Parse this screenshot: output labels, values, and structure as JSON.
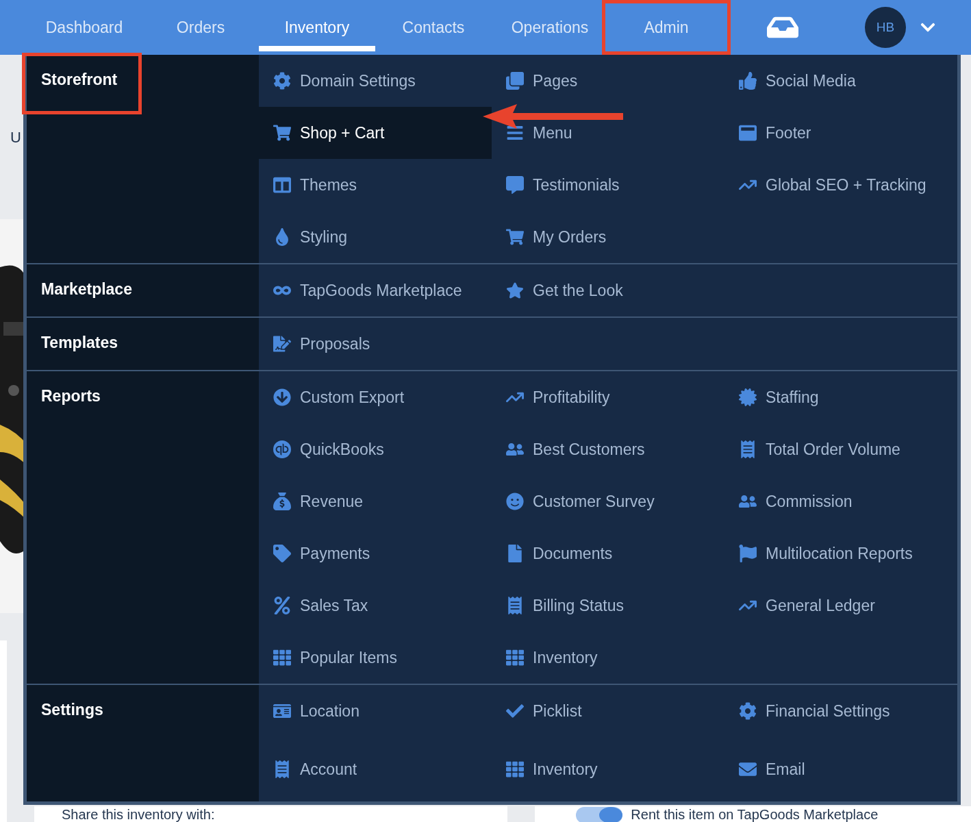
{
  "nav": {
    "items": [
      {
        "label": "Dashboard",
        "selected": false,
        "highlighted": false
      },
      {
        "label": "Orders",
        "selected": false,
        "highlighted": false
      },
      {
        "label": "Inventory",
        "selected": true,
        "highlighted": false
      },
      {
        "label": "Contacts",
        "selected": false,
        "highlighted": false
      },
      {
        "label": "Operations",
        "selected": false,
        "highlighted": false
      },
      {
        "label": "Admin",
        "selected": false,
        "highlighted": true
      }
    ],
    "avatar": "HB"
  },
  "menu": {
    "sections": [
      {
        "title": "Storefront",
        "highlighted": true,
        "items": [
          {
            "label": "Domain Settings",
            "selected": false,
            "pointed": false
          },
          {
            "label": "Pages",
            "selected": false,
            "pointed": false
          },
          {
            "label": "Social Media",
            "selected": false,
            "pointed": false
          },
          {
            "label": "Shop + Cart",
            "selected": true,
            "pointed": true
          },
          {
            "label": "Menu",
            "selected": false,
            "pointed": false
          },
          {
            "label": "Footer",
            "selected": false,
            "pointed": false
          },
          {
            "label": "Themes",
            "selected": false,
            "pointed": false
          },
          {
            "label": "Testimonials",
            "selected": false,
            "pointed": false
          },
          {
            "label": "Global SEO + Tracking",
            "selected": false,
            "pointed": false
          },
          {
            "label": "Styling",
            "selected": false,
            "pointed": false
          },
          {
            "label": "My Orders",
            "selected": false,
            "pointed": false
          }
        ]
      },
      {
        "title": "Marketplace",
        "highlighted": false,
        "items": [
          {
            "label": "TapGoods Marketplace",
            "selected": false,
            "pointed": false
          },
          {
            "label": "Get the Look",
            "selected": false,
            "pointed": false
          }
        ]
      },
      {
        "title": "Templates",
        "highlighted": false,
        "items": [
          {
            "label": "Proposals",
            "selected": false,
            "pointed": false
          }
        ]
      },
      {
        "title": "Reports",
        "highlighted": false,
        "items": [
          {
            "label": "Custom Export",
            "selected": false,
            "pointed": false
          },
          {
            "label": "Profitability",
            "selected": false,
            "pointed": false
          },
          {
            "label": "Staffing",
            "selected": false,
            "pointed": false
          },
          {
            "label": "QuickBooks",
            "selected": false,
            "pointed": false
          },
          {
            "label": "Best Customers",
            "selected": false,
            "pointed": false
          },
          {
            "label": "Total Order Volume",
            "selected": false,
            "pointed": false
          },
          {
            "label": "Revenue",
            "selected": false,
            "pointed": false
          },
          {
            "label": "Customer Survey",
            "selected": false,
            "pointed": false
          },
          {
            "label": "Commission",
            "selected": false,
            "pointed": false
          },
          {
            "label": "Payments",
            "selected": false,
            "pointed": false
          },
          {
            "label": "Documents",
            "selected": false,
            "pointed": false
          },
          {
            "label": "Multilocation Reports",
            "selected": false,
            "pointed": false
          },
          {
            "label": "Sales Tax",
            "selected": false,
            "pointed": false
          },
          {
            "label": "Billing Status",
            "selected": false,
            "pointed": false
          },
          {
            "label": "General Ledger",
            "selected": false,
            "pointed": false
          },
          {
            "label": "Popular Items",
            "selected": false,
            "pointed": false
          },
          {
            "label": "Inventory",
            "selected": false,
            "pointed": false
          }
        ]
      },
      {
        "title": "Settings",
        "highlighted": false,
        "items": [
          {
            "label": "Location",
            "selected": false,
            "pointed": false
          },
          {
            "label": "Picklist",
            "selected": false,
            "pointed": false
          },
          {
            "label": "Financial Settings",
            "selected": false,
            "pointed": false
          },
          {
            "label": "Account",
            "selected": false,
            "pointed": false
          },
          {
            "label": "Inventory",
            "selected": false,
            "pointed": false
          },
          {
            "label": "Email",
            "selected": false,
            "pointed": false
          }
        ]
      }
    ]
  },
  "page": {
    "partial_text": "U",
    "share_label": "Share this inventory with:",
    "toggle": {
      "label": "Rent this item on TapGoods Marketplace",
      "on": true
    }
  }
}
